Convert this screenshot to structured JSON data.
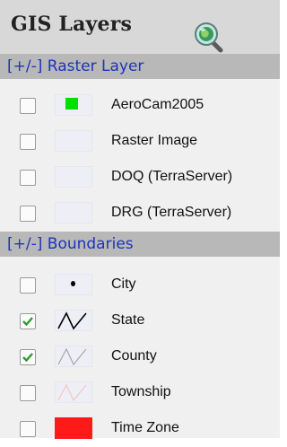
{
  "panel": {
    "title": "GIS Layers",
    "zoom_icon": "magnifier-globe-icon"
  },
  "sections": [
    {
      "toggle": "[+/-]",
      "title": "Raster Layer",
      "layers": [
        {
          "label": "AeroCam2005",
          "checked": false,
          "swatch": "green-square"
        },
        {
          "label": "Raster Image",
          "checked": false,
          "swatch": "blank"
        },
        {
          "label": "DOQ (TerraServer)",
          "checked": false,
          "swatch": "blank"
        },
        {
          "label": "DRG (TerraServer)",
          "checked": false,
          "swatch": "blank"
        }
      ]
    },
    {
      "toggle": "[+/-]",
      "title": "Boundaries",
      "layers": [
        {
          "label": "City",
          "checked": false,
          "swatch": "dot"
        },
        {
          "label": "State",
          "checked": true,
          "swatch": "black-line"
        },
        {
          "label": "County",
          "checked": true,
          "swatch": "gray-line"
        },
        {
          "label": "Township",
          "checked": false,
          "swatch": "light-red-line"
        },
        {
          "label": "Time Zone",
          "checked": false,
          "swatch": "red-fill"
        }
      ]
    }
  ],
  "colors": {
    "section_text": "#1c34b9",
    "check": "#2e9b2e",
    "green_swatch": "#00e000",
    "red_swatch": "#ff1a1a"
  }
}
